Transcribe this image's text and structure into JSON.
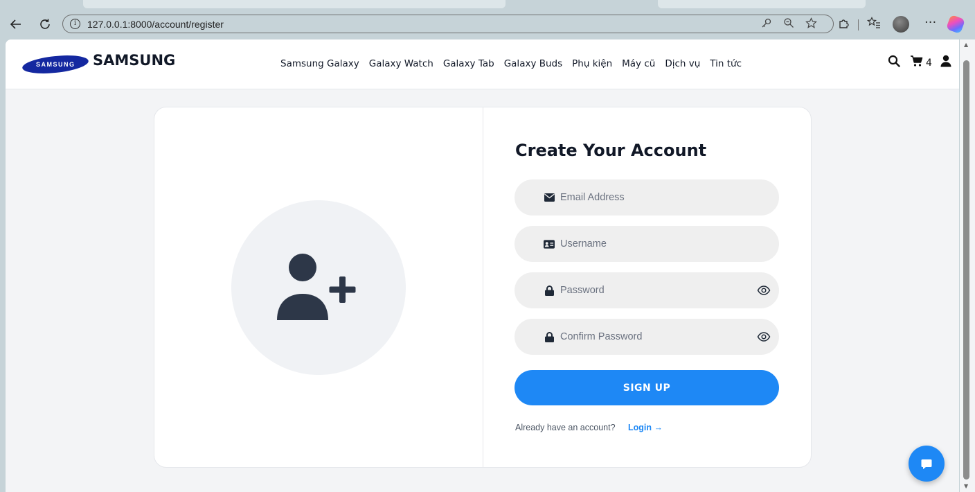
{
  "browser": {
    "url": "127.0.0.1:8000/account/register"
  },
  "header": {
    "logo_text": "SAMSUNG",
    "brand": "SAMSUNG",
    "nav": [
      {
        "label": "Samsung Galaxy"
      },
      {
        "label": "Galaxy Watch"
      },
      {
        "label": "Galaxy Tab"
      },
      {
        "label": "Galaxy Buds"
      },
      {
        "label": "Phụ kiện"
      },
      {
        "label": "Máy cũ"
      },
      {
        "label": "Dịch vụ"
      },
      {
        "label": "Tin tức"
      }
    ],
    "cart_count": "4"
  },
  "form": {
    "title": "Create Your Account",
    "email_placeholder": "Email Address",
    "username_placeholder": "Username",
    "password_placeholder": "Password",
    "confirm_placeholder": "Confirm Password",
    "submit_label": "SIGN UP",
    "already_text": "Already have an account?",
    "login_label": "Login →"
  },
  "colors": {
    "accent": "#1e88f5",
    "brand_blue": "#1428a0",
    "icon_dark": "#2d3748",
    "field_bg": "#efefef"
  },
  "icons": {
    "back": "back-arrow-icon",
    "refresh": "refresh-icon",
    "search": "search-icon",
    "cart": "cart-icon",
    "user": "user-icon",
    "email": "envelope-icon",
    "username": "id-card-icon",
    "password": "lock-icon",
    "eye": "eye-icon",
    "add_user": "user-plus-icon",
    "chat": "chat-icon"
  }
}
